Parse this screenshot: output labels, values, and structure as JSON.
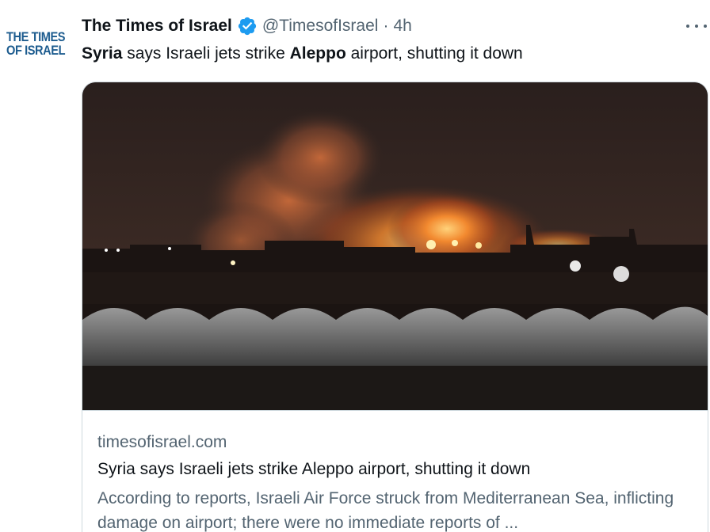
{
  "author": {
    "display_name": "The Times of Israel",
    "handle": "@TimesofIsrael",
    "separator": "·",
    "time": "4h",
    "avatar_logo": [
      "THE TIMES",
      "OF ISRAEL"
    ],
    "verified_icon": "verified-badge-icon"
  },
  "tweet": {
    "parts": [
      {
        "text": "Syria",
        "bold": true
      },
      {
        "text": " says Israeli jets strike ",
        "bold": false
      },
      {
        "text": "Aleppo",
        "bold": true
      },
      {
        "text": " airport, shutting it down",
        "bold": false
      }
    ]
  },
  "card": {
    "image_alt_icon": "explosion-photo",
    "domain": "timesofisrael.com",
    "title": "Syria says Israeli jets strike Aleppo airport, shutting it down",
    "description": "According to reports, Israeli Air Force struck from Mediterranean Sea, inflicting damage on airport; there were no immediate reports of ..."
  },
  "menu": {
    "more_icon": "more-options-icon"
  },
  "colors": {
    "text_primary": "#0f1419",
    "text_secondary": "#536471",
    "verified_blue": "#1d9bf0",
    "border": "#cfd9de",
    "logo_blue": "#1d5c8f"
  }
}
